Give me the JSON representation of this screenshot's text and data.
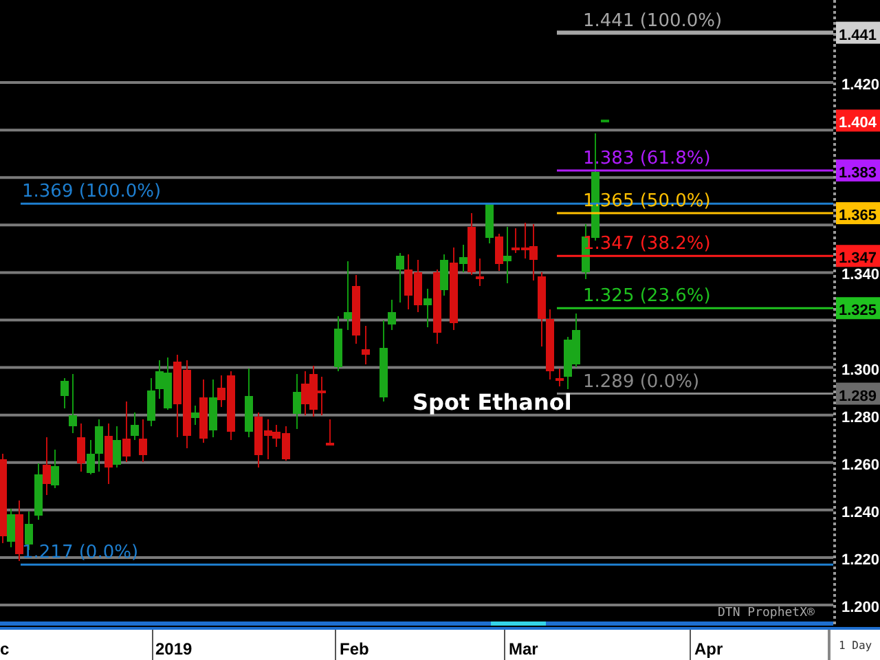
{
  "chart": {
    "legend": "Spot Ethanol",
    "watermark": "DTN ProphetX®"
  },
  "fib_levels": [
    {
      "label": "1.441 (100.0%)",
      "color": "#a6a6a6",
      "kind": "short"
    },
    {
      "label": "1.383 (61.8%)",
      "color": "#b01cff",
      "kind": "short"
    },
    {
      "label": "1.369 (100.0%)",
      "color": "#1e7fd0",
      "kind": "long"
    },
    {
      "label": "1.365 (50.0%)",
      "color": "#ffc000",
      "kind": "short"
    },
    {
      "label": "1.347 (38.2%)",
      "color": "#ff1a1a",
      "kind": "short"
    },
    {
      "label": "1.325 (23.6%)",
      "color": "#1fc21f",
      "kind": "short"
    },
    {
      "label": "1.289 (0.0%)",
      "color": "#8a8a8a",
      "kind": "short"
    },
    {
      "label": "1.217 (0.0%)",
      "color": "#1e7fd0",
      "kind": "long"
    }
  ],
  "price_axis": {
    "ticks": [
      "1.420",
      "1.340",
      "1.300",
      "1.280",
      "1.260",
      "1.240",
      "1.220",
      "1.200"
    ],
    "badges": [
      {
        "text": "1.441",
        "color": "#d0d0d0"
      },
      {
        "text": "1.404",
        "color": "#ff1a1a"
      },
      {
        "text": "1.383",
        "color": "#b01cff"
      },
      {
        "text": "1.365",
        "color": "#ffc000"
      },
      {
        "text": "1.347",
        "color": "#ff1a1a"
      },
      {
        "text": "1.325",
        "color": "#1fc21f"
      },
      {
        "text": "1.289",
        "color": "#6a6a6a"
      }
    ]
  },
  "time_axis": {
    "labels": [
      "c",
      "2019",
      "Feb",
      "Mar",
      "Apr"
    ],
    "interval": "1 Day"
  }
}
